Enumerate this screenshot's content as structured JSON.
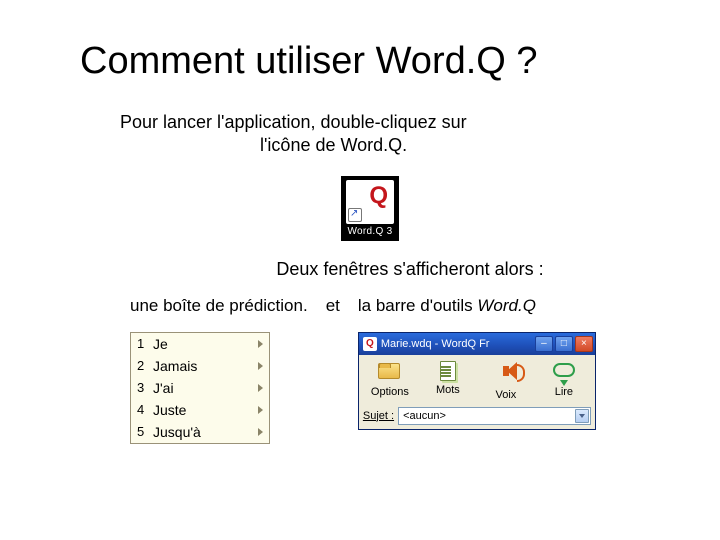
{
  "title": "Comment utiliser Word.Q ?",
  "instruction_line1": "Pour lancer l'application, double-cliquez  sur",
  "instruction_line2": "l'icône de Word.Q.",
  "desktop_icon": {
    "letter": "Q",
    "label": "Word.Q 3"
  },
  "subline": "Deux fenêtres s'afficheront alors :",
  "left_caption": "une boîte de prédiction.",
  "mid_word": "et",
  "right_caption_plain": "la barre d'outils ",
  "right_caption_ital": "Word.Q",
  "predictions": [
    {
      "n": "1",
      "w": "Je"
    },
    {
      "n": "2",
      "w": "Jamais"
    },
    {
      "n": "3",
      "w": "J'ai"
    },
    {
      "n": "4",
      "w": "Juste"
    },
    {
      "n": "5",
      "w": "Jusqu'à"
    }
  ],
  "wordq_window": {
    "title": "Marie.wdq - WordQ Fr",
    "appicon_letter": "Q",
    "minimize": "–",
    "maximize": "□",
    "close": "×",
    "buttons": [
      {
        "label": "Options"
      },
      {
        "label": "Mots"
      },
      {
        "label": "Voix"
      },
      {
        "label": "Lire"
      }
    ],
    "subject_label": "Sujet :",
    "subject_value": "<aucun>"
  }
}
